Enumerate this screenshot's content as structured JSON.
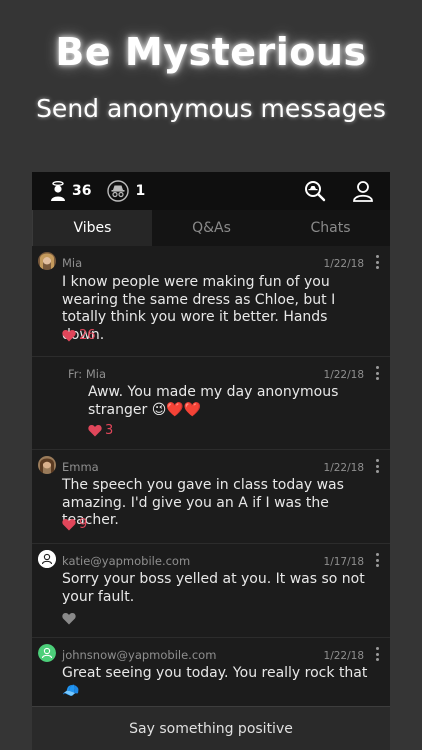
{
  "promo": {
    "headline": "Be Mysterious",
    "subline": "Send anonymous messages"
  },
  "topbar": {
    "followers_count": "36",
    "anonymous_count": "1",
    "followers_icon": "person-halo-icon",
    "anonymous_icon": "incognito-icon",
    "search_icon": "search-icon",
    "profile_icon": "profile-icon"
  },
  "tabs": [
    {
      "label": "Vibes",
      "active": true
    },
    {
      "label": "Q&As",
      "active": false
    },
    {
      "label": "Chats",
      "active": false
    }
  ],
  "posts": [
    {
      "author": "Mia",
      "date": "1/22/18",
      "text": "I know people were making fun of you wearing the same dress as Chloe, but I totally think you wore it better. Hands down.",
      "likes": "26"
    },
    {
      "author": "Fr: Mia",
      "date": "1/22/18",
      "text": "Aww.  You made my day anonymous stranger 😉❤️❤️",
      "likes": "3"
    },
    {
      "author": "Emma",
      "date": "1/22/18",
      "text": "The speech you gave in class today was amazing. I'd give you an A if I was the teacher.",
      "likes": "9"
    },
    {
      "author": "katie@yapmobile.com",
      "date": "1/17/18",
      "text": "Sorry your boss yelled at you.  It was so not your fault.",
      "likes": ""
    },
    {
      "author": "johnsnow@yapmobile.com",
      "date": "1/22/18",
      "text": "Great seeing you today.  You really rock that 🧢",
      "likes": ""
    }
  ],
  "compose": {
    "placeholder": "Say something positive"
  },
  "colors": {
    "background": "#353535",
    "like_red": "#e0465a",
    "like_gray": "#8a8a8a"
  }
}
